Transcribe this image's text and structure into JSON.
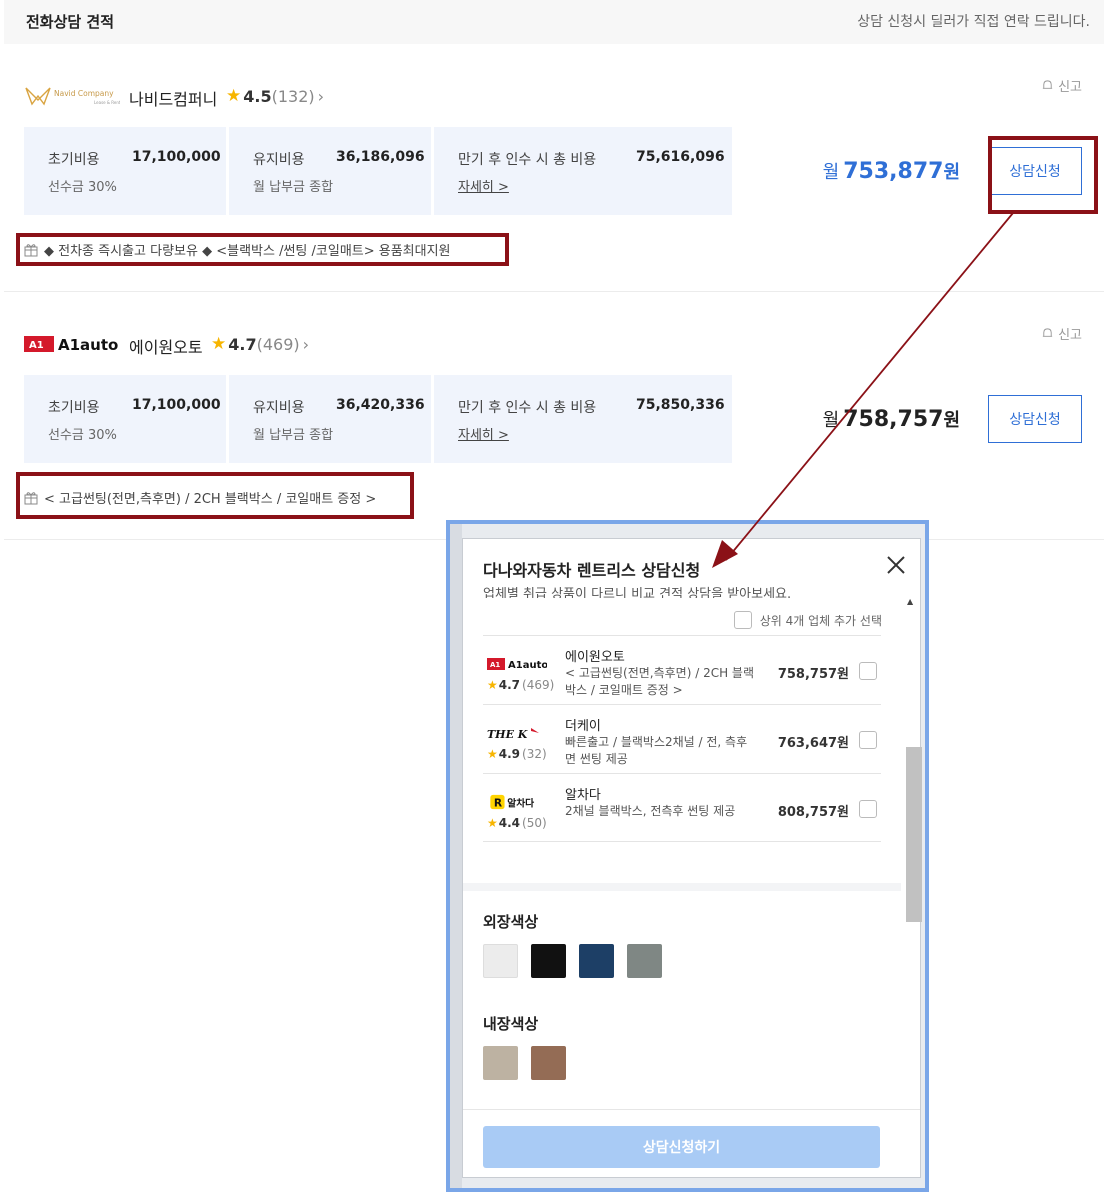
{
  "header": {
    "title": "전화상담 견적",
    "notice": "상담 신청시 딜러가 직접 연락 드립니다."
  },
  "dealers": [
    {
      "logo_text": "Navid Company",
      "name": "나비드컴퍼니",
      "score": "4.5",
      "count": "(132)",
      "report": "신고",
      "initial_label": "초기비용",
      "initial_value": "17,100,000",
      "initial_sub": "선수금 30%",
      "maint_label": "유지비용",
      "maint_value": "36,186,096",
      "maint_sub": "월 납부금 종합",
      "expiry_label": "만기 후 인수 시 총 비용",
      "expiry_value": "75,616,096",
      "detail_link": "자세히 >",
      "monthly_prefix": "월",
      "monthly_value": "753,877",
      "monthly_unit": "원",
      "apply": "상담신청",
      "promo": "◆ 전차종 즉시출고 다량보유 ◆ <블랙박스 /썬팅 /코일매트> 용품최대지원"
    },
    {
      "logo_text": "A1auto",
      "name": "에이원오토",
      "score": "4.7",
      "count": "(469)",
      "report": "신고",
      "initial_label": "초기비용",
      "initial_value": "17,100,000",
      "initial_sub": "선수금 30%",
      "maint_label": "유지비용",
      "maint_value": "36,420,336",
      "maint_sub": "월 납부금 종합",
      "expiry_label": "만기 후 인수 시 총 비용",
      "expiry_value": "75,850,336",
      "detail_link": "자세히 >",
      "monthly_prefix": "월",
      "monthly_value": "758,757",
      "monthly_unit": "원",
      "apply": "상담신청",
      "promo": "< 고급썬팅(전면,측후면) / 2CH 블랙박스 / 코일매트 증정 >"
    }
  ],
  "modal": {
    "title": "다나와자동차 렌트리스 상담신청",
    "description": "업체별 취급 상품이 다르니 비교 견적 상담을 받아보세요.",
    "top4_label": "상위 4개 업체 추가 선택",
    "items": [
      {
        "logo": "A1auto",
        "score": "4.7",
        "count": "(469)",
        "name": "에이원오토",
        "desc": "< 고급썬팅(전면,측후면) / 2CH 블랙박스 / 코일매트 증정 >",
        "price": "758,757원"
      },
      {
        "logo": "THE K",
        "score": "4.9",
        "count": "(32)",
        "name": "더케이",
        "desc": "빠른출고 / 블랙박스2채널 / 전, 측후면 썬팅 제공",
        "price": "763,647원"
      },
      {
        "logo": "알차다",
        "score": "4.4",
        "count": "(50)",
        "name": "알차다",
        "desc": "2채널 블랙박스, 전측후 썬팅 제공",
        "price": "808,757원"
      }
    ],
    "exterior_title": "외장색상",
    "exterior_colors": [
      "#ececec",
      "#111111",
      "#1d3f66",
      "#7f8784"
    ],
    "interior_title": "내장색상",
    "interior_colors": [
      "#bdb2a2",
      "#946c55"
    ],
    "submit": "상담신청하기"
  },
  "annotation_color": "#8b1117"
}
